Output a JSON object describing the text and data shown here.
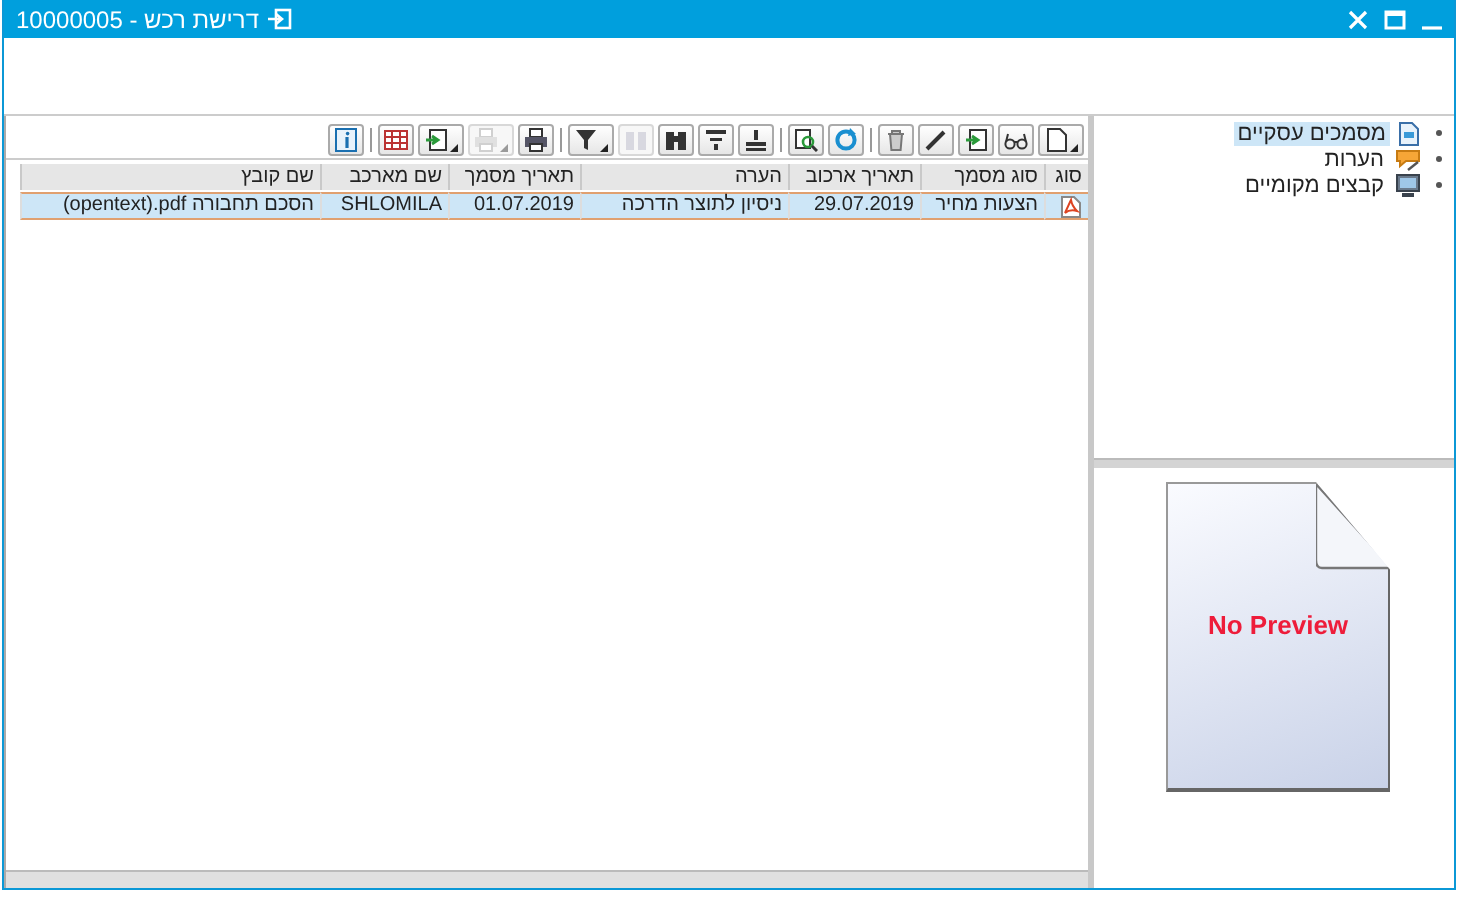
{
  "window": {
    "title": "דרישת רכש - 10000005"
  },
  "toolbar": [
    {
      "kind": "document",
      "dropdown": true,
      "disabled": false
    },
    {
      "kind": "glasses",
      "dropdown": false,
      "disabled": false
    },
    {
      "kind": "import",
      "dropdown": false,
      "disabled": false
    },
    {
      "kind": "pencil",
      "dropdown": false,
      "disabled": false
    },
    {
      "kind": "trash",
      "dropdown": false,
      "disabled": false
    },
    {
      "kind": "separator"
    },
    {
      "kind": "refresh",
      "dropdown": false,
      "disabled": false
    },
    {
      "kind": "zoom",
      "dropdown": false,
      "disabled": false
    },
    {
      "kind": "separator"
    },
    {
      "kind": "sort-up",
      "dropdown": false,
      "disabled": false
    },
    {
      "kind": "sort-down",
      "dropdown": false,
      "disabled": false
    },
    {
      "kind": "binoculars",
      "dropdown": false,
      "disabled": false
    },
    {
      "kind": "find-next",
      "dropdown": false,
      "disabled": true
    },
    {
      "kind": "filter",
      "dropdown": true,
      "disabled": false
    },
    {
      "kind": "separator"
    },
    {
      "kind": "print",
      "dropdown": false,
      "disabled": false
    },
    {
      "kind": "print-view",
      "dropdown": true,
      "disabled": true
    },
    {
      "kind": "export",
      "dropdown": true,
      "disabled": false
    },
    {
      "kind": "grid",
      "dropdown": false,
      "disabled": false
    },
    {
      "kind": "separator"
    },
    {
      "kind": "info",
      "dropdown": false,
      "disabled": false
    }
  ],
  "table": {
    "columns": [
      "סוג",
      "סוג מסמך",
      "תאריך ארכוב",
      "הערה",
      "תאריך מסמך",
      "שם מארכב",
      "שם קובץ"
    ],
    "rows": [
      {
        "selected": true,
        "cells": [
          "",
          "הצעות מחיר",
          "29.07.2019",
          "ניסיון לתוצר הדרכה",
          "01.07.2019",
          "SHLOMILA",
          "(opentext).pdf הסכם תחבורה"
        ]
      }
    ]
  },
  "tree": {
    "items": [
      {
        "label": "מסמכים עסקיים",
        "kind": "document",
        "selected": true
      },
      {
        "label": "הערות",
        "kind": "note",
        "selected": false
      },
      {
        "label": "קבצים מקומיים",
        "kind": "computer",
        "selected": false
      }
    ]
  },
  "preview": {
    "text": "No Preview"
  }
}
